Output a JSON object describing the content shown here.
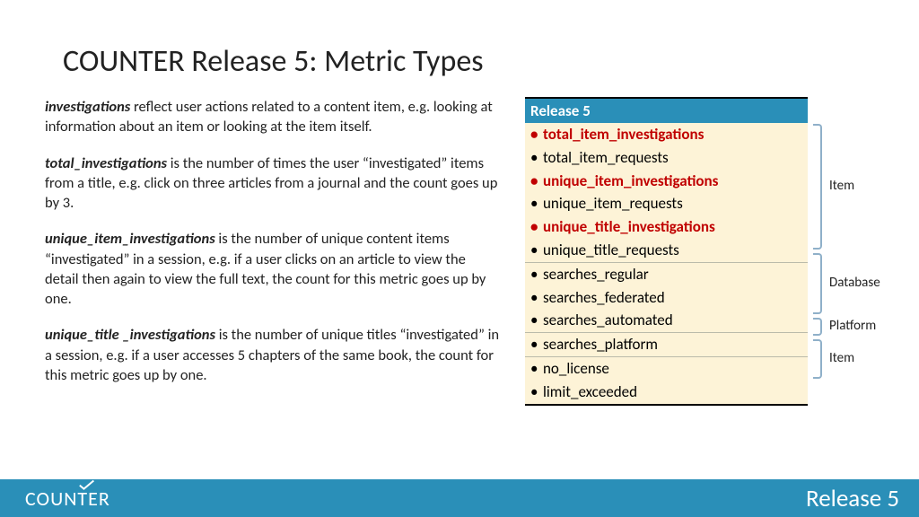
{
  "title": "COUNTER Release 5: Metric Types",
  "paragraphs": [
    {
      "term": "investigations",
      "text": " reflect user actions related to a content item, e.g. looking at information about an item or looking at the item itself."
    },
    {
      "term": "total_investigations",
      "text": " is the number of times the user “investigated” items from a title, e.g. click on three articles from a journal and the count goes up by 3."
    },
    {
      "term": "unique_item_investigations",
      "text": " is the number of unique content items “investigated” in a session, e.g. if a user clicks on an article to view the detail then again to view the full text, the count for this metric goes up by one."
    },
    {
      "term": "unique_title _investigations",
      "text": " is the number of unique titles “investigated” in a session, e.g. if a user accesses 5 chapters of the same book, the count for this metric goes up by one."
    }
  ],
  "table": {
    "header": "Release 5",
    "groups": [
      {
        "label": "Item",
        "rows": [
          {
            "text": "total_item_investigations",
            "hl": true
          },
          {
            "text": "total_item_requests",
            "hl": false
          },
          {
            "text": "unique_item_investigations",
            "hl": true
          },
          {
            "text": "unique_item_requests",
            "hl": false
          },
          {
            "text": "unique_title_investigations",
            "hl": true
          },
          {
            "text": "unique_title_requests",
            "hl": false
          }
        ]
      },
      {
        "label": "Database",
        "rows": [
          {
            "text": "searches_regular",
            "hl": false
          },
          {
            "text": "searches_federated",
            "hl": false
          },
          {
            "text": "searches_automated",
            "hl": false
          }
        ]
      },
      {
        "label": "Platform",
        "rows": [
          {
            "text": "searches_platform",
            "hl": false
          }
        ]
      },
      {
        "label": "Item",
        "rows": [
          {
            "text": "no_license",
            "hl": false
          },
          {
            "text": "limit_exceeded",
            "hl": false
          }
        ]
      }
    ]
  },
  "footer": {
    "logo": "COUNTER",
    "right": "Release 5"
  }
}
